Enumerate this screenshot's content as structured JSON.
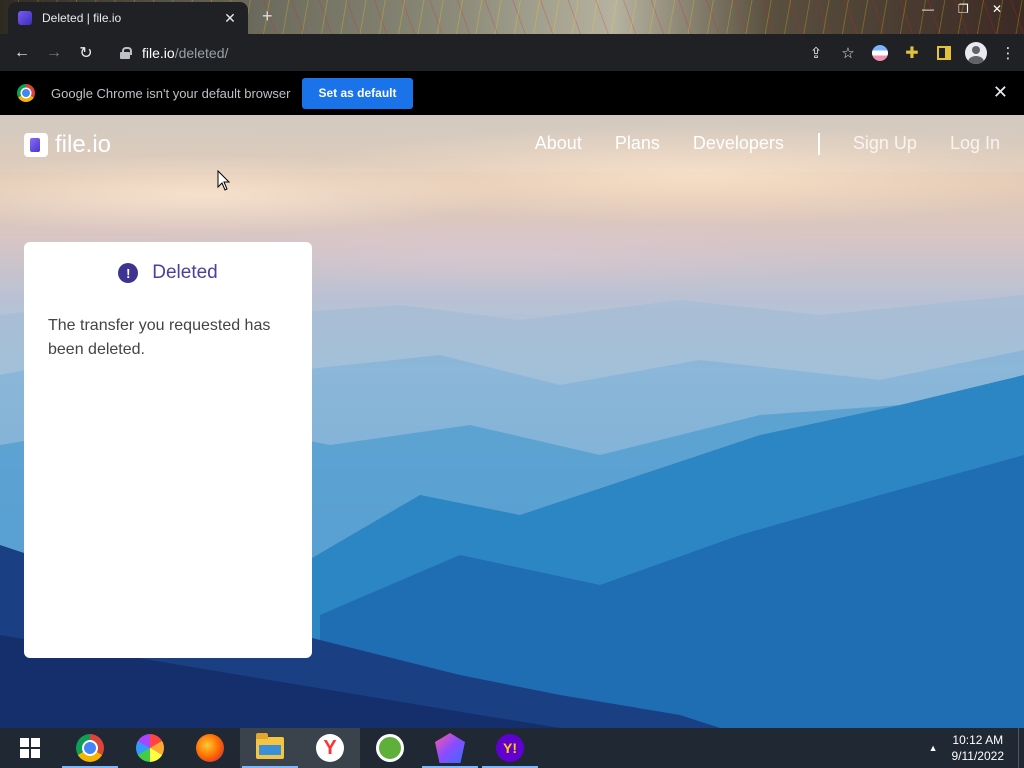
{
  "browser": {
    "tab": {
      "title": "Deleted | file.io",
      "close_glyph": "✕"
    },
    "new_tab_glyph": "+",
    "window_controls": {
      "minimize": "—",
      "maximize": "❐",
      "close": "✕"
    },
    "nav": {
      "back_glyph": "←",
      "forward_glyph": "→",
      "reload_glyph": "↻"
    },
    "url": {
      "host": "file.io",
      "path": "/deleted/"
    },
    "toolbar_icons": [
      "share-icon",
      "star-icon",
      "extension-icon",
      "puzzle-icon",
      "side-panel-icon",
      "profile-icon",
      "menu-icon"
    ],
    "share_glyph": "⇪",
    "star_glyph": "☆",
    "puzzle_glyph": "✚",
    "menu_glyph": "⋮"
  },
  "infobar": {
    "message": "Google Chrome isn't your default browser",
    "button_label": "Set as default",
    "close_glyph": "✕"
  },
  "site": {
    "brand": "file.io",
    "nav": {
      "about": "About",
      "plans": "Plans",
      "developers": "Developers",
      "signup": "Sign Up",
      "login": "Log In"
    }
  },
  "card": {
    "icon_glyph": "!",
    "title": "Deleted",
    "message": "The transfer you requested has been deleted."
  },
  "taskbar": {
    "apps": [
      "start",
      "chrome",
      "pinwheel",
      "firefox",
      "file-explorer",
      "yandex",
      "green-app",
      "gem-app",
      "yahoo-messenger"
    ],
    "yandex_glyph": "Y",
    "yahoo_glyph": "Y!",
    "tray_up_glyph": "▲",
    "time": "10:12 AM",
    "date": "9/11/2022"
  },
  "colors": {
    "accent": "#1a73e8",
    "card_title": "#4c3f9e",
    "alert_icon": "#3e3391"
  }
}
